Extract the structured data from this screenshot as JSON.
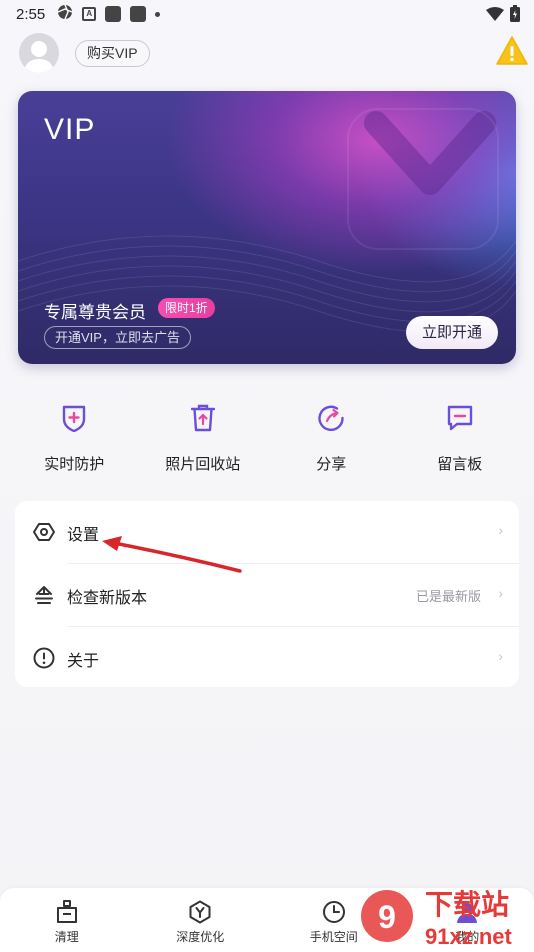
{
  "status_bar": {
    "time": "2:55"
  },
  "header": {
    "buy_vip": "购买VIP",
    "warning_icon": "warning-icon"
  },
  "vip_card": {
    "title": "VIP",
    "member_label": "专属尊贵会员",
    "badge": "限时1折",
    "subtitle": "开通VIP，立即去广告",
    "open_button": "立即开通"
  },
  "quick_actions": [
    {
      "label": "实时防护",
      "icon": "shield-icon"
    },
    {
      "label": "照片回收站",
      "icon": "trash-icon"
    },
    {
      "label": "分享",
      "icon": "share-icon"
    },
    {
      "label": "留言板",
      "icon": "message-board-icon"
    }
  ],
  "settings_list": [
    {
      "label": "设置",
      "icon": "settings-icon",
      "value": ""
    },
    {
      "label": "检查新版本",
      "icon": "update-icon",
      "value": "已是最新版"
    },
    {
      "label": "关于",
      "icon": "info-icon",
      "value": ""
    }
  ],
  "bottom_nav": [
    {
      "label": "清理",
      "icon": "clean-icon"
    },
    {
      "label": "深度优化",
      "icon": "optimize-icon"
    },
    {
      "label": "手机空间",
      "icon": "storage-icon"
    },
    {
      "label": "我的",
      "icon": "profile-icon"
    }
  ],
  "watermark": {
    "brand_text": "下载站",
    "url_text": "91xz.net"
  },
  "colors": {
    "accent_purple": "#6a50d8",
    "badge_pink": "#ee46a8",
    "arrow_red": "#d9262c",
    "warning_yellow": "#f7c21a"
  }
}
